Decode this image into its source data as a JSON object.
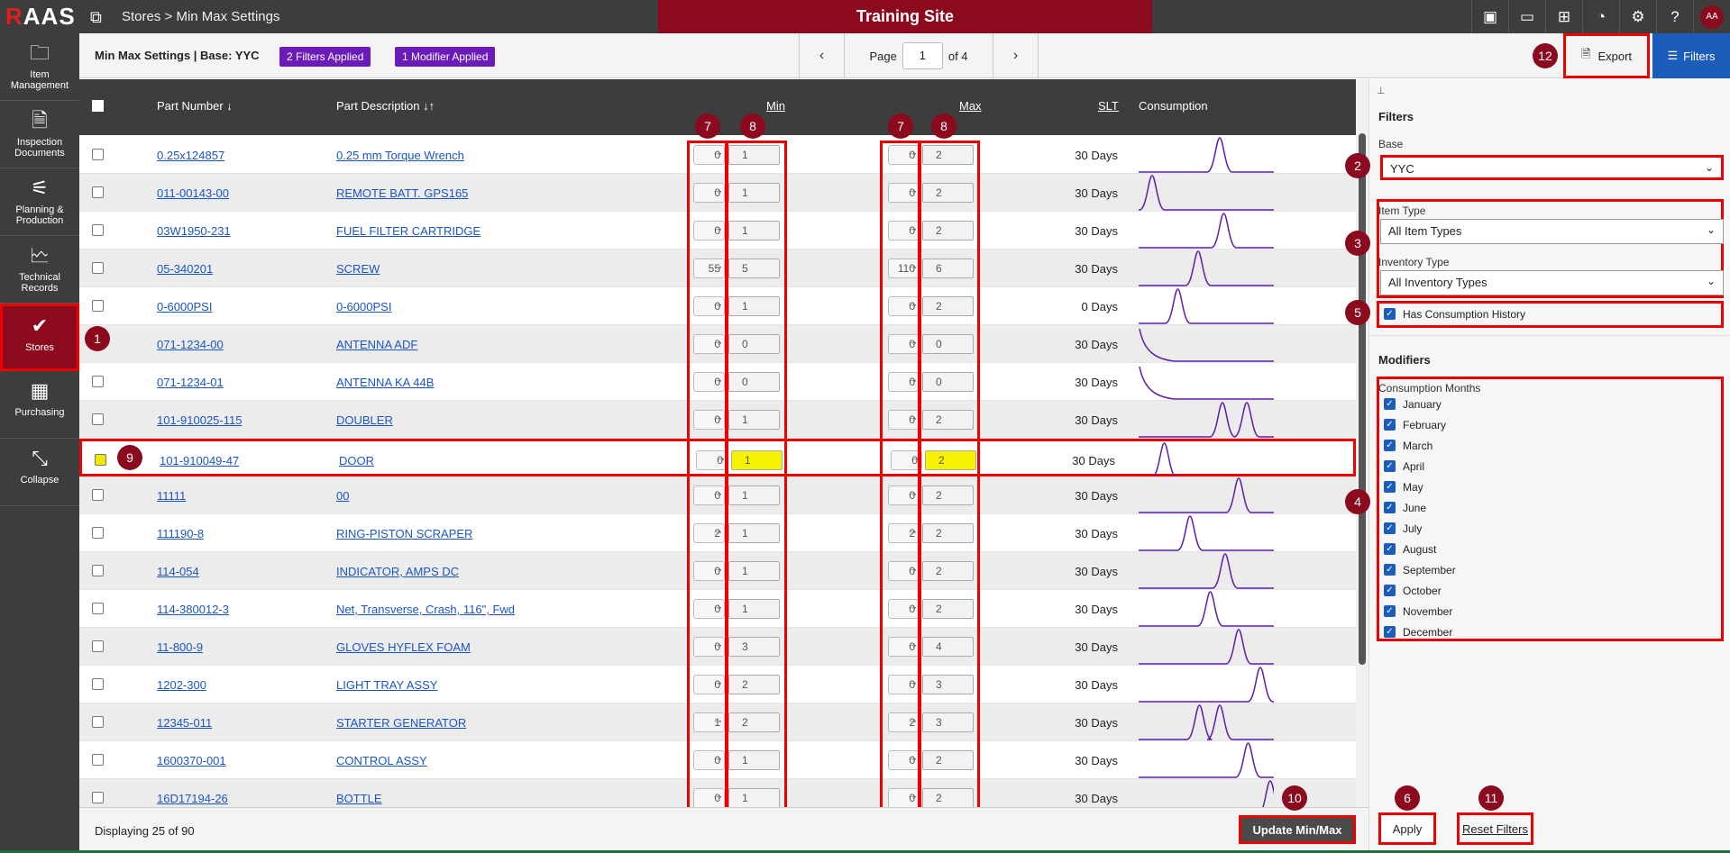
{
  "app": {
    "logo_r": "R",
    "logo_rest": "AAS",
    "breadcrumb": "Stores > Min Max Settings",
    "site_banner": "Training Site",
    "avatar": "AA"
  },
  "sidebar": {
    "items": [
      {
        "label": "Item Management",
        "icon": "folder-icon",
        "glyph": "🗀"
      },
      {
        "label": "Inspection Documents",
        "icon": "document-icon",
        "glyph": "🗎"
      },
      {
        "label": "Planning & Production",
        "icon": "workflow-icon",
        "glyph": "⚟"
      },
      {
        "label": "Technical Records",
        "icon": "records-icon",
        "glyph": "🗠"
      },
      {
        "label": "Stores",
        "icon": "clipboard-check-icon",
        "glyph": "✔"
      },
      {
        "label": "Purchasing",
        "icon": "calculator-icon",
        "glyph": "▦"
      },
      {
        "label": "Collapse",
        "icon": "collapse-icon",
        "glyph": "⤡"
      }
    ]
  },
  "toolbar": {
    "title": "Min Max Settings | Base: YYC",
    "filters_badge": "2 Filters Applied",
    "modifier_badge": "1 Modifier Applied",
    "page_label": "Page",
    "page_value": "1",
    "page_of": "of 4",
    "export_label": "Export",
    "filters_label": "Filters"
  },
  "table": {
    "headers": {
      "part_number": "Part Number ↓",
      "part_description": "Part Description ↓↑",
      "min": "Min",
      "max": "Max",
      "slt": "SLT",
      "consumption": "Consumption"
    },
    "rows": [
      {
        "pn": "0.25x124857",
        "desc": "0.25 mm Torque Wrench",
        "cur_min": "0",
        "new_min": "1",
        "cur_max": "0",
        "new_max": "2",
        "slt": "30 Days",
        "spikes": [
          0.6
        ]
      },
      {
        "pn": "011-00143-00",
        "desc": "REMOTE BATT. GPS165",
        "cur_min": "0",
        "new_min": "1",
        "cur_max": "0",
        "new_max": "2",
        "slt": "30 Days",
        "spikes": [
          0.1
        ]
      },
      {
        "pn": "03W1950-231",
        "desc": "FUEL FILTER CARTRIDGE",
        "cur_min": "0",
        "new_min": "1",
        "cur_max": "0",
        "new_max": "2",
        "slt": "30 Days",
        "spikes": [
          0.63
        ]
      },
      {
        "pn": "05-340201",
        "desc": "SCREW",
        "cur_min": "55",
        "new_min": "5",
        "cur_max": "110",
        "new_max": "6",
        "slt": "30 Days",
        "spikes": [
          0.44
        ]
      },
      {
        "pn": "0-6000PSI",
        "desc": "0-6000PSI",
        "cur_min": "0",
        "new_min": "1",
        "cur_max": "0",
        "new_max": "2",
        "slt": "0 Days",
        "spikes": [
          0.29
        ]
      },
      {
        "pn": "071-1234-00",
        "desc": "ANTENNA ADF",
        "cur_min": "0",
        "new_min": "0",
        "cur_max": "0",
        "new_max": "0",
        "slt": "30 Days",
        "spikes": [
          0.0
        ]
      },
      {
        "pn": "071-1234-01",
        "desc": "ANTENNA KA 44B",
        "cur_min": "0",
        "new_min": "0",
        "cur_max": "0",
        "new_max": "0",
        "slt": "30 Days",
        "spikes": [
          0.0
        ]
      },
      {
        "pn": "101-910025-115",
        "desc": "DOUBLER",
        "cur_min": "0",
        "new_min": "1",
        "cur_max": "0",
        "new_max": "2",
        "slt": "30 Days",
        "spikes": [
          0.62,
          0.8
        ]
      },
      {
        "pn": "101-910049-47",
        "desc": "DOOR",
        "cur_min": "0",
        "new_min": "1",
        "cur_max": "0",
        "new_max": "2",
        "slt": "30 Days",
        "spikes": [
          0.17
        ],
        "selected": true
      },
      {
        "pn": "11111",
        "desc": "00",
        "cur_min": "0",
        "new_min": "1",
        "cur_max": "0",
        "new_max": "2",
        "slt": "30 Days",
        "spikes": [
          0.74
        ]
      },
      {
        "pn": "111190-8",
        "desc": "RING-PISTON SCRAPER",
        "cur_min": "2",
        "new_min": "1",
        "cur_max": "2",
        "new_max": "2",
        "slt": "30 Days",
        "spikes": [
          0.38
        ]
      },
      {
        "pn": "114-054",
        "desc": "INDICATOR, AMPS DC",
        "cur_min": "0",
        "new_min": "1",
        "cur_max": "0",
        "new_max": "2",
        "slt": "30 Days",
        "spikes": [
          0.64
        ]
      },
      {
        "pn": "114-380012-3",
        "desc": "Net, Transverse, Crash, 116\", Fwd",
        "cur_min": "0",
        "new_min": "1",
        "cur_max": "0",
        "new_max": "2",
        "slt": "30 Days",
        "spikes": [
          0.53
        ]
      },
      {
        "pn": "11-800-9",
        "desc": "GLOVES HYFLEX FOAM",
        "cur_min": "0",
        "new_min": "3",
        "cur_max": "0",
        "new_max": "4",
        "slt": "30 Days",
        "spikes": [
          0.74
        ]
      },
      {
        "pn": "1202-300",
        "desc": "LIGHT TRAY ASSY",
        "cur_min": "0",
        "new_min": "2",
        "cur_max": "0",
        "new_max": "3",
        "slt": "30 Days",
        "spikes": [
          0.9
        ]
      },
      {
        "pn": "12345-011",
        "desc": "STARTER GENERATOR",
        "cur_min": "1",
        "new_min": "2",
        "cur_max": "2",
        "new_max": "3",
        "slt": "30 Days",
        "spikes": [
          0.45,
          0.6
        ]
      },
      {
        "pn": "1600370-001",
        "desc": "CONTROL ASSY",
        "cur_min": "0",
        "new_min": "1",
        "cur_max": "0",
        "new_max": "2",
        "slt": "30 Days",
        "spikes": [
          0.81
        ]
      },
      {
        "pn": "16D17194-26",
        "desc": "BOTTLE",
        "cur_min": "0",
        "new_min": "1",
        "cur_max": "0",
        "new_max": "2",
        "slt": "30 Days",
        "spikes": [
          1.0
        ]
      }
    ]
  },
  "footer": {
    "displaying": "Displaying 25 of 90",
    "update_label": "Update Min/Max"
  },
  "panel": {
    "filters_heading": "Filters",
    "base_label": "Base",
    "base_value": "YYC",
    "item_type_label": "Item Type",
    "item_type_value": "All Item Types",
    "inventory_type_label": "Inventory Type",
    "inventory_type_value": "All Inventory Types",
    "consumption_history_label": "Has Consumption History",
    "modifiers_heading": "Modifiers",
    "consumption_months_label": "Consumption Months",
    "months": [
      "January",
      "February",
      "March",
      "April",
      "May",
      "June",
      "July",
      "August",
      "September",
      "October",
      "November",
      "December"
    ],
    "apply_label": "Apply",
    "reset_label": "Reset Filters"
  },
  "markers": [
    "1",
    "2",
    "3",
    "4",
    "5",
    "6",
    "7",
    "8",
    "9",
    "10",
    "11",
    "12"
  ],
  "colors": {
    "brand_red": "#8b0a1e",
    "accent_blue": "#1c5dbb",
    "purple_badge": "#6a1bb8",
    "spark": "#5b1ea8"
  }
}
